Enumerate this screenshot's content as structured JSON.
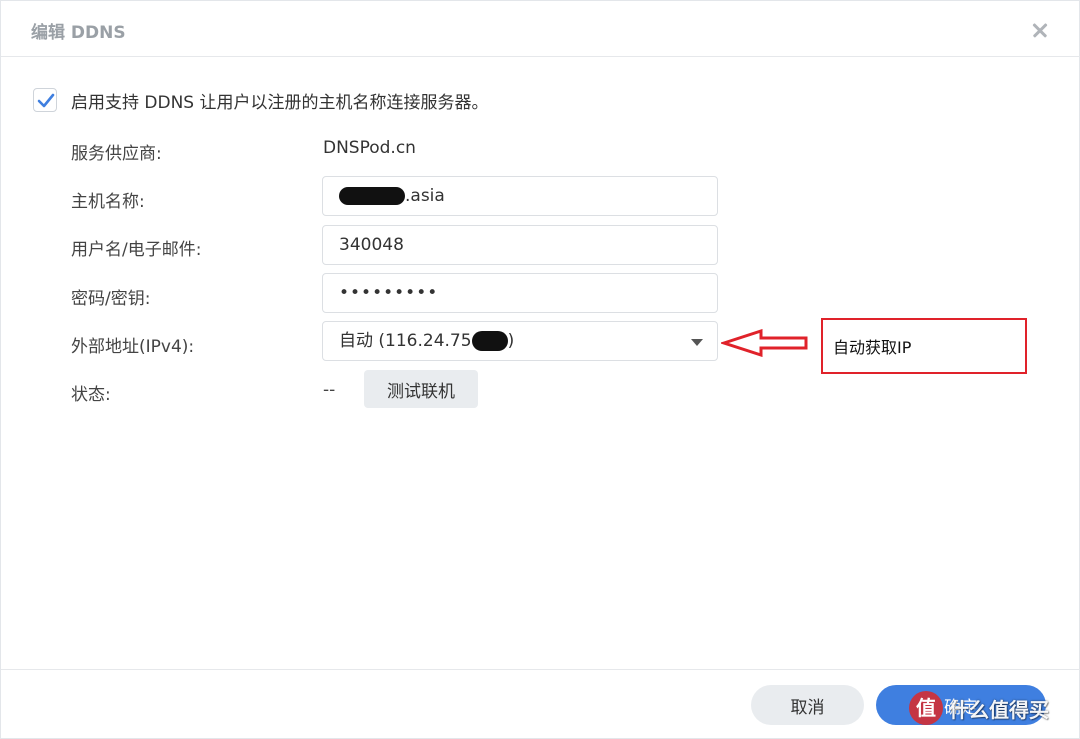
{
  "dialog": {
    "title": "编辑 DDNS",
    "enable_label": "启用支持 DDNS 让用户以注册的主机名称连接服务器。",
    "enable_checked": true
  },
  "form": {
    "provider_label": "服务供应商:",
    "provider_value": "DNSPod.cn",
    "hostname_label": "主机名称:",
    "hostname_suffix": ".asia",
    "username_label": "用户名/电子邮件:",
    "username_value": "340048",
    "password_label": "密码/密钥:",
    "password_value": "•••••••••",
    "external_label": "外部地址(IPv4):",
    "external_prefix": "自动 (116.24.75",
    "external_suffix": ")",
    "status_label": "状态:",
    "status_value": "--",
    "test_button": "测试联机"
  },
  "annotation": {
    "text": "自动获取IP",
    "color": "#e0222a"
  },
  "footer": {
    "cancel": "取消",
    "ok": "确定"
  },
  "watermark": {
    "logo": "值",
    "text": "什么值得买"
  },
  "colors": {
    "accent": "#3f7fe0",
    "button_gray": "#e9ecef"
  }
}
